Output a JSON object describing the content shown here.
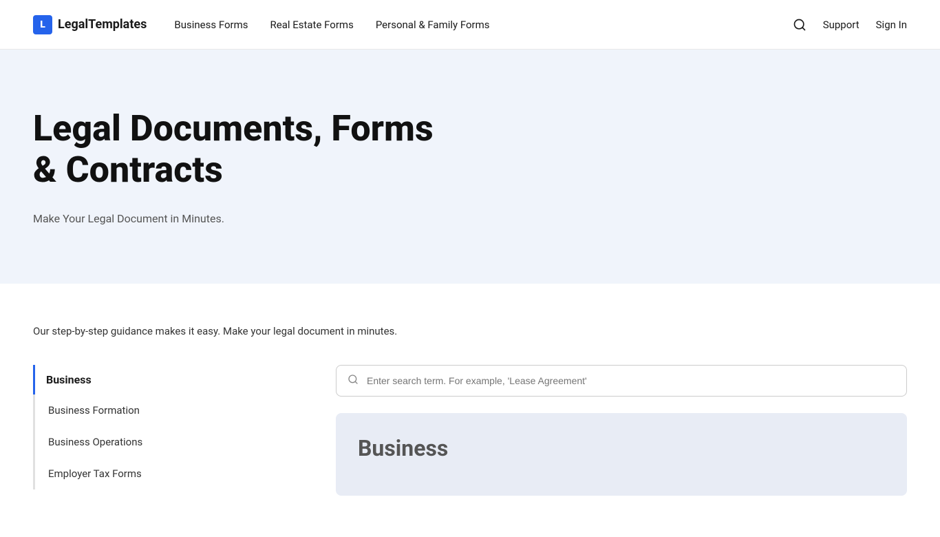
{
  "brand": {
    "icon_letter": "L",
    "name": "LegalTemplates"
  },
  "navbar": {
    "links": [
      {
        "label": "Business Forms",
        "id": "business-forms"
      },
      {
        "label": "Real Estate Forms",
        "id": "real-estate-forms"
      },
      {
        "label": "Personal & Family Forms",
        "id": "personal-family-forms"
      }
    ],
    "actions": {
      "support": "Support",
      "signin": "Sign In"
    }
  },
  "hero": {
    "title": "Legal Documents, Forms & Contracts",
    "subtitle": "Make Your Legal Document in Minutes."
  },
  "content": {
    "intro": "Our step-by-step guidance makes it easy. Make your legal document in minutes.",
    "sidebar": {
      "active_category": "Business",
      "items": [
        {
          "label": "Business Formation",
          "id": "business-formation"
        },
        {
          "label": "Business Operations",
          "id": "business-operations"
        },
        {
          "label": "Employer Tax Forms",
          "id": "employer-tax-forms"
        }
      ]
    },
    "search": {
      "placeholder": "Enter search term. For example, 'Lease Agreement'"
    },
    "business_card": {
      "title": "Business"
    }
  }
}
